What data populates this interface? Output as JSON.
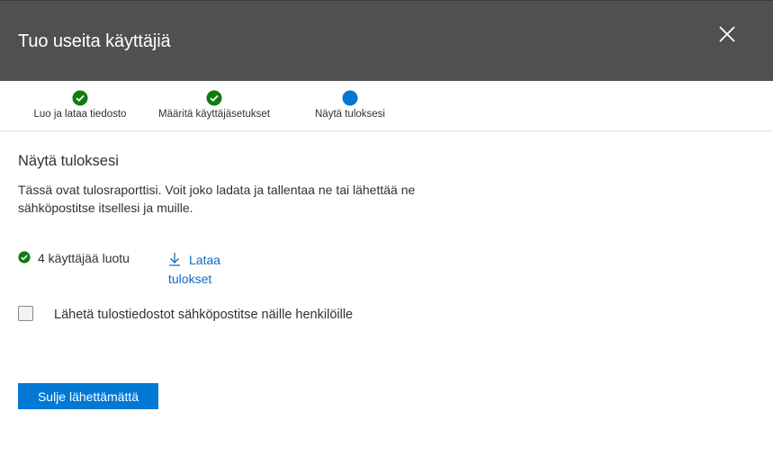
{
  "header": {
    "title": "Tuo useita käyttäjiä",
    "close_icon": "close-icon"
  },
  "steps": [
    {
      "label": "Luo ja lataa tiedosto",
      "status": "completed",
      "icon": "checkmark-circle-icon"
    },
    {
      "label": "Määritä käyttäjäsetukset",
      "status": "completed",
      "icon": "checkmark-circle-icon"
    },
    {
      "label": "Näytä tuloksesi",
      "status": "current",
      "icon": "current-step-dot-icon"
    }
  ],
  "content": {
    "section_title": "Näytä tuloksesi",
    "description": "Tässä ovat tulosraporttisi. Voit joko ladata ja tallentaa ne tai lähettää ne sähköpostitse itsellesi ja muille.",
    "result_text": "4 käyttäjää luotu",
    "download_label": "Lataa tulokset",
    "download_icon": "download-icon",
    "email_checkbox_label": "Lähetä tulostiedostot sähköpostitse näille henkilöille",
    "email_checkbox_checked": false
  },
  "footer": {
    "close_without_sending_label": "Sulje lähettämättä"
  },
  "colors": {
    "header_bg": "#505050",
    "accent": "#0078d4",
    "success": "#107c10",
    "link": "#0f6cbd"
  }
}
